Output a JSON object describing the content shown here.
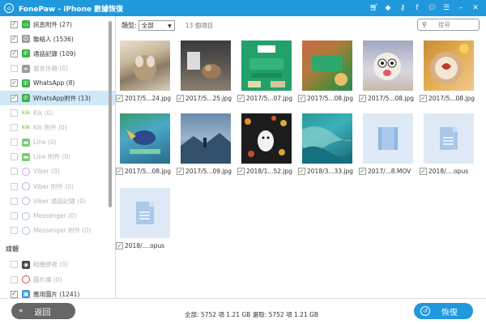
{
  "window": {
    "title": "FonePaw - iPhone 數據恢復"
  },
  "sidebar": {
    "items": [
      {
        "label": "訊息附件 (27)",
        "checked": true,
        "icon": "message-attachment-icon"
      },
      {
        "label": "聯絡人 (1536)",
        "checked": true,
        "icon": "contacts-icon"
      },
      {
        "label": "通話記錄 (109)",
        "checked": true,
        "icon": "call-log-icon"
      },
      {
        "label": "留言信箱 (0)",
        "checked": false,
        "icon": "voicemail-icon"
      },
      {
        "label": "WhatsApp (8)",
        "checked": true,
        "icon": "whatsapp-icon"
      },
      {
        "label": "WhatsApp附件 (13)",
        "checked": true,
        "icon": "whatsapp-attachment-icon"
      },
      {
        "label": "Kik (0)",
        "checked": false,
        "icon": "kik-icon"
      },
      {
        "label": "Kik 附件 (0)",
        "checked": false,
        "icon": "kik-attachment-icon"
      },
      {
        "label": "Line (0)",
        "checked": false,
        "icon": "line-icon"
      },
      {
        "label": "Line 附件 (0)",
        "checked": false,
        "icon": "line-attachment-icon"
      },
      {
        "label": "Viber (0)",
        "checked": false,
        "icon": "viber-icon"
      },
      {
        "label": "Viber 附件 (0)",
        "checked": false,
        "icon": "viber-attachment-icon"
      },
      {
        "label": "Viber 通話記錄 (0)",
        "checked": false,
        "icon": "viber-call-log-icon"
      },
      {
        "label": "Messenger (0)",
        "checked": false,
        "icon": "messenger-icon"
      },
      {
        "label": "Messenger 附件 (0)",
        "checked": false,
        "icon": "messenger-attachment-icon"
      }
    ],
    "section_media": "媒體",
    "media_items": [
      {
        "label": "相機膠卷 (0)",
        "checked": false,
        "icon": "camera-roll-icon"
      },
      {
        "label": "圖片庫 (0)",
        "checked": false,
        "icon": "photo-library-icon"
      },
      {
        "label": "應用圖片 (1241)",
        "checked": true,
        "icon": "app-photos-icon"
      }
    ]
  },
  "toolbar": {
    "type_label": "類型:",
    "type_value": "全部",
    "count_text": "13 個項目",
    "search_placeholder": "搜尋"
  },
  "files": [
    {
      "name": "2017/5...24.jpg",
      "kind": "photo"
    },
    {
      "name": "2017/5...25.jpg",
      "kind": "photo"
    },
    {
      "name": "2017/5...07.jpg",
      "kind": "photo"
    },
    {
      "name": "2017/5...08.jpg",
      "kind": "photo"
    },
    {
      "name": "2017/5...08.jpg",
      "kind": "photo"
    },
    {
      "name": "2017/5...08.jpg",
      "kind": "photo"
    },
    {
      "name": "2017/5...08.jpg",
      "kind": "photo"
    },
    {
      "name": "2017/5...09.jpg",
      "kind": "photo"
    },
    {
      "name": "2018/1...52.jpg",
      "kind": "photo"
    },
    {
      "name": "2018/3...33.jpg",
      "kind": "photo"
    },
    {
      "name": "2017/...8.MOV",
      "kind": "video"
    },
    {
      "name": "2018/....opus",
      "kind": "audio"
    },
    {
      "name": "2018/....opus",
      "kind": "audio"
    }
  ],
  "bottom": {
    "back_label": "返回",
    "status_text": "全部: 5752 項 1.21 GB 選取: 5752 項 1.21 GB",
    "recover_label": "恢復"
  },
  "colors": {
    "accent": "#1f98dc",
    "selected_row": "#cfe8f8",
    "back_button": "#666666"
  }
}
